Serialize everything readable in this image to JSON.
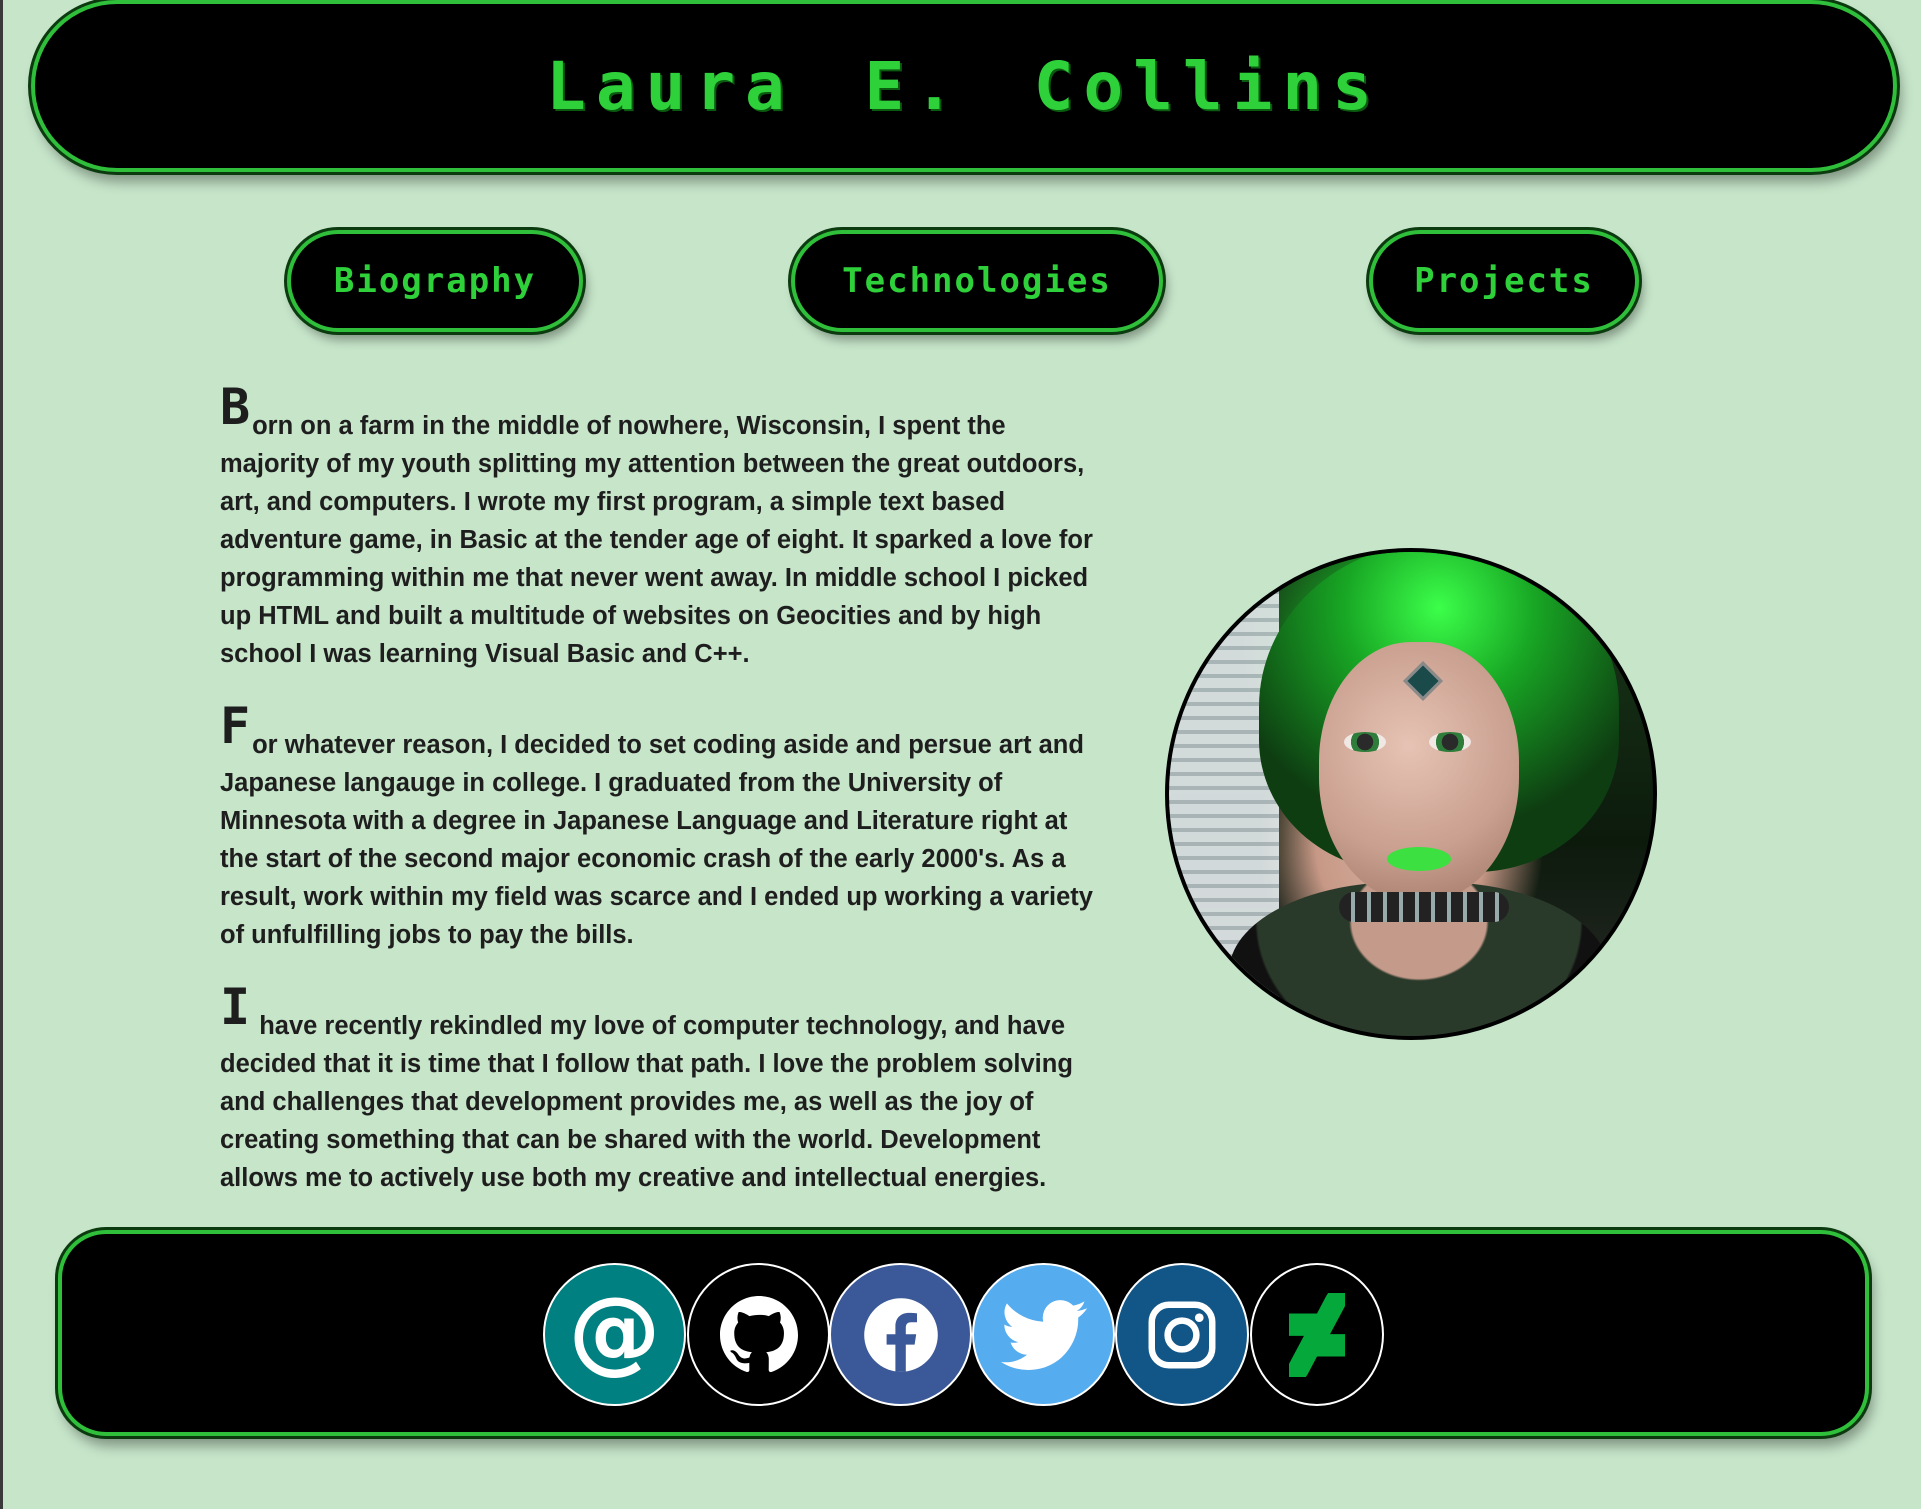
{
  "header": {
    "title": "Laura E. Collins"
  },
  "nav": {
    "biography": "Biography",
    "technologies": "Technologies",
    "projects": "Projects"
  },
  "bio": {
    "paragraphs": [
      {
        "initial": "B",
        "text": "orn on a farm in the middle of nowhere, Wisconsin, I spent the majority of my youth splitting my attention between the great outdoors, art, and computers. I wrote my first program, a simple text based adventure game, in Basic at the tender age of eight. It sparked a love for programming within me that never went away. In middle school I picked up HTML and built a multitude of websites on Geocities and by high school I was learning Visual Basic and C++."
      },
      {
        "initial": "F",
        "text": "or whatever reason, I decided to set coding aside and persue art and Japanese langauge in college. I graduated from the University of Minnesota with a degree in Japanese Language and Literature right at the start of the second major economic crash of the early 2000's. As a result, work within my field was scarce and I ended up working a variety of unfulfilling jobs to pay the bills."
      },
      {
        "initial": "I",
        "text": " have recently rekindled my love of computer technology, and have decided that it is time that I follow that path. I love the problem solving and challenges that development provides me, as well as the joy of creating something that can be shared with the world. Development allows me to actively use both my creative and intellectual energies."
      }
    ]
  },
  "social": {
    "email_glyph": "@",
    "icons": [
      "email-icon",
      "github-icon",
      "facebook-icon",
      "twitter-icon",
      "instagram-icon",
      "deviantart-icon"
    ]
  },
  "colors": {
    "background": "#c6e5c9",
    "accent": "#2ed13a",
    "email": "#008080",
    "facebook": "#3b5998",
    "twitter": "#55acee",
    "instagram": "#125688",
    "deviantart": "#05cc47"
  }
}
